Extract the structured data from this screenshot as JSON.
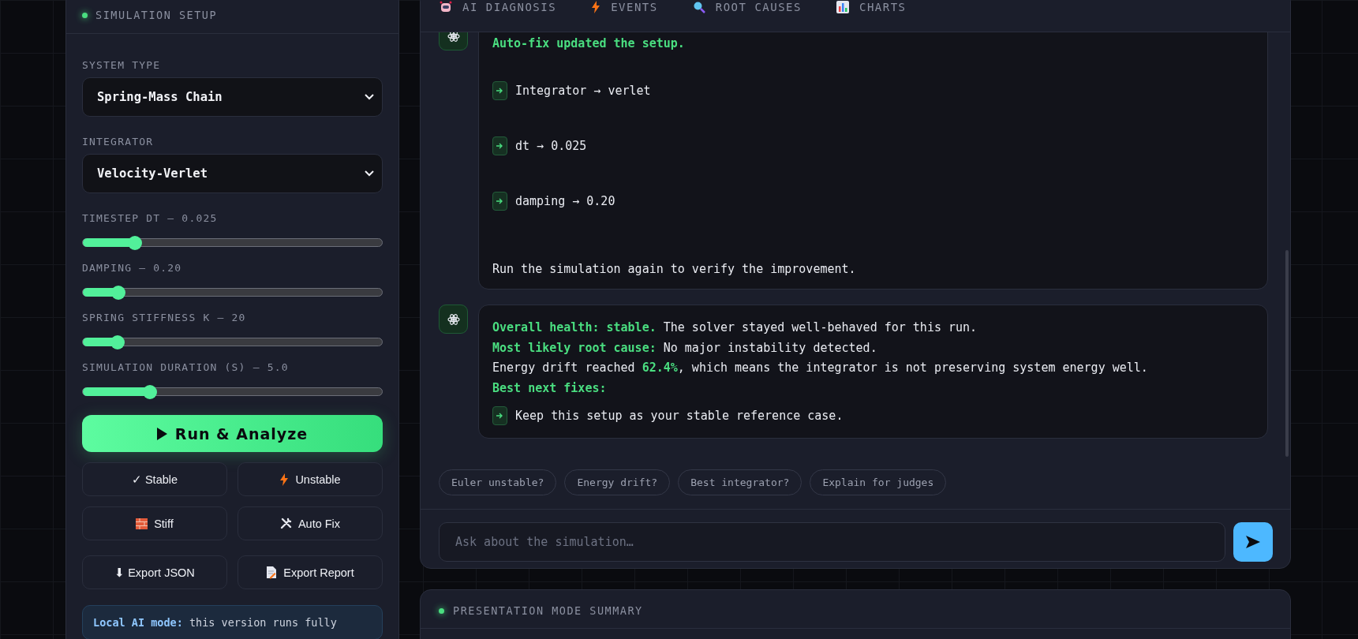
{
  "setup": {
    "title": "SIMULATION SETUP",
    "fields": [
      {
        "kind": "select",
        "label": "SYSTEM TYPE",
        "value": "Spring-Mass Chain"
      },
      {
        "kind": "select",
        "label": "INTEGRATOR",
        "value": "Velocity-Verlet"
      },
      {
        "kind": "slider",
        "label": "TIMESTEP DT — 0.025",
        "level": 0.175
      },
      {
        "kind": "slider",
        "label": "DAMPING — 0.20",
        "level": 0.12
      },
      {
        "kind": "slider",
        "label": "SPRING STIFFNESS K — 20",
        "level": 0.115
      },
      {
        "kind": "slider",
        "label": "SIMULATION DURATION (S) — 5.0",
        "level": 0.225
      }
    ],
    "run_button": "Run & Analyze",
    "buttons": [
      "✓ Stable",
      "Unstable",
      "Stiff",
      "Auto Fix",
      "⬇ Export JSON",
      "Export Report"
    ],
    "note": "**Local AI mode:** this version runs fully"
  },
  "tabs": [
    {
      "label": "AI DIAGNOSIS",
      "selected": false
    },
    {
      "label": "EVENTS",
      "selected": false
    },
    {
      "label": "ROOT CAUSES",
      "selected": false
    },
    {
      "label": "CHARTS",
      "selected": false
    }
  ],
  "messages": [
    {
      "kind": "fix",
      "title": "Auto-fix updated the setup.",
      "items": [
        "Integrator → verlet",
        "dt → 0.025",
        "damping → 0.20"
      ],
      "footer": "Run the simulation again to verify the improvement."
    },
    {
      "kind": "report",
      "lines": [
        "**Overall health: stable.** The solver stayed well-behaved for this run.",
        "**Most likely root cause:** No major instability detected.",
        "Energy drift reached **62.4%**, which means the integrator is not preserving system energy well.",
        "**Best next fixes:**"
      ],
      "items": [
        "Keep this setup as your stable reference case."
      ]
    }
  ],
  "suggestions": [
    "Euler unstable?",
    "Energy drift?",
    "Best integrator?",
    "Explain for judges"
  ],
  "input": {
    "placeholder": "Ask about the simulation…"
  },
  "summary": {
    "title": "PRESENTATION MODE SUMMARY"
  }
}
